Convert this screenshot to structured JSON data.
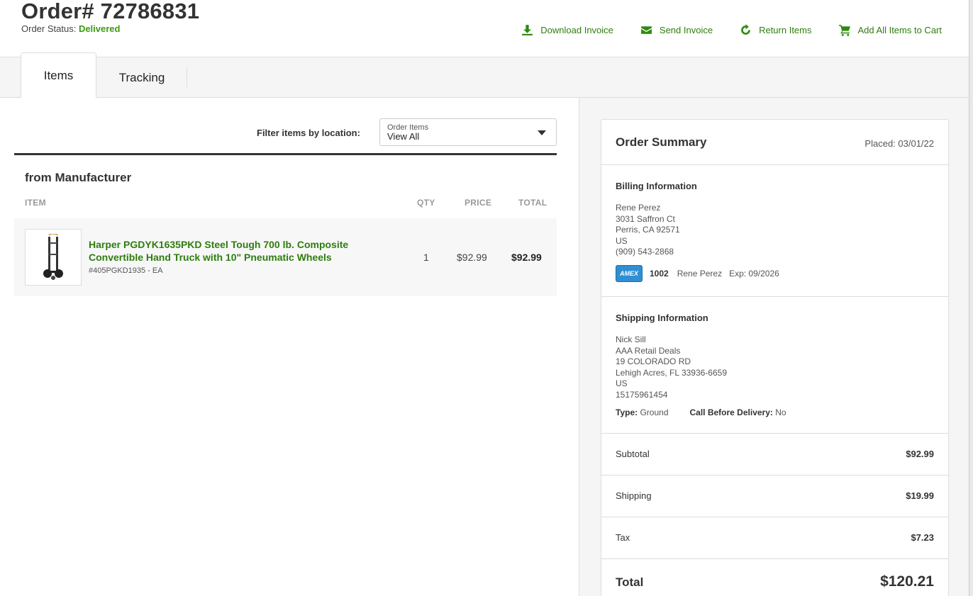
{
  "header": {
    "order_title": "Order# 72786831",
    "status_label": "Order Status:",
    "status_value": "Delivered",
    "actions": {
      "download": "Download Invoice",
      "send": "Send Invoice",
      "return": "Return Items",
      "add_cart": "Add All Items to Cart"
    }
  },
  "tabs": {
    "items": "Items",
    "tracking": "Tracking"
  },
  "filter": {
    "label": "Filter items by location:",
    "select_small": "Order Items",
    "select_value": "View All"
  },
  "items_section": {
    "title": "from Manufacturer",
    "columns": {
      "item": "ITEM",
      "qty": "QTY",
      "price": "PRICE",
      "total": "TOTAL"
    },
    "rows": [
      {
        "name": "Harper PGDYK1635PKD Steel Tough 700 lb. Composite Convertible Hand Truck with 10\" Pneumatic Wheels",
        "sku": "#405PGKD1935 - EA",
        "qty": "1",
        "price": "$92.99",
        "total": "$92.99"
      }
    ]
  },
  "summary": {
    "title": "Order Summary",
    "placed": "Placed: 03/01/22",
    "billing": {
      "title": "Billing Information",
      "name": "Rene Perez",
      "street": "3031 Saffron Ct",
      "city": "Perris, CA 92571",
      "country": "US",
      "phone": "(909) 543-2868",
      "card_brand": "AMEX",
      "card_last4": "1002",
      "card_name": "Rene Perez",
      "card_exp": "Exp: 09/2026"
    },
    "shipping": {
      "title": "Shipping Information",
      "name": "Nick Sill",
      "company": "AAA Retail Deals",
      "street": "19 COLORADO RD",
      "city": "Lehigh Acres, FL 33936-6659",
      "country": "US",
      "phone": "15175961454",
      "type_label": "Type:",
      "type_value": "Ground",
      "call_label": "Call Before Delivery:",
      "call_value": "No"
    },
    "subtotal_label": "Subtotal",
    "subtotal": "$92.99",
    "shipping_label": "Shipping",
    "shipping_cost": "$19.99",
    "tax_label": "Tax",
    "tax": "$7.23",
    "total_label": "Total",
    "total": "$120.21"
  },
  "colors": {
    "accent_green": "#2e7d0e",
    "status_green": "#3a9b10",
    "amex_blue": "#2f8fd3"
  }
}
